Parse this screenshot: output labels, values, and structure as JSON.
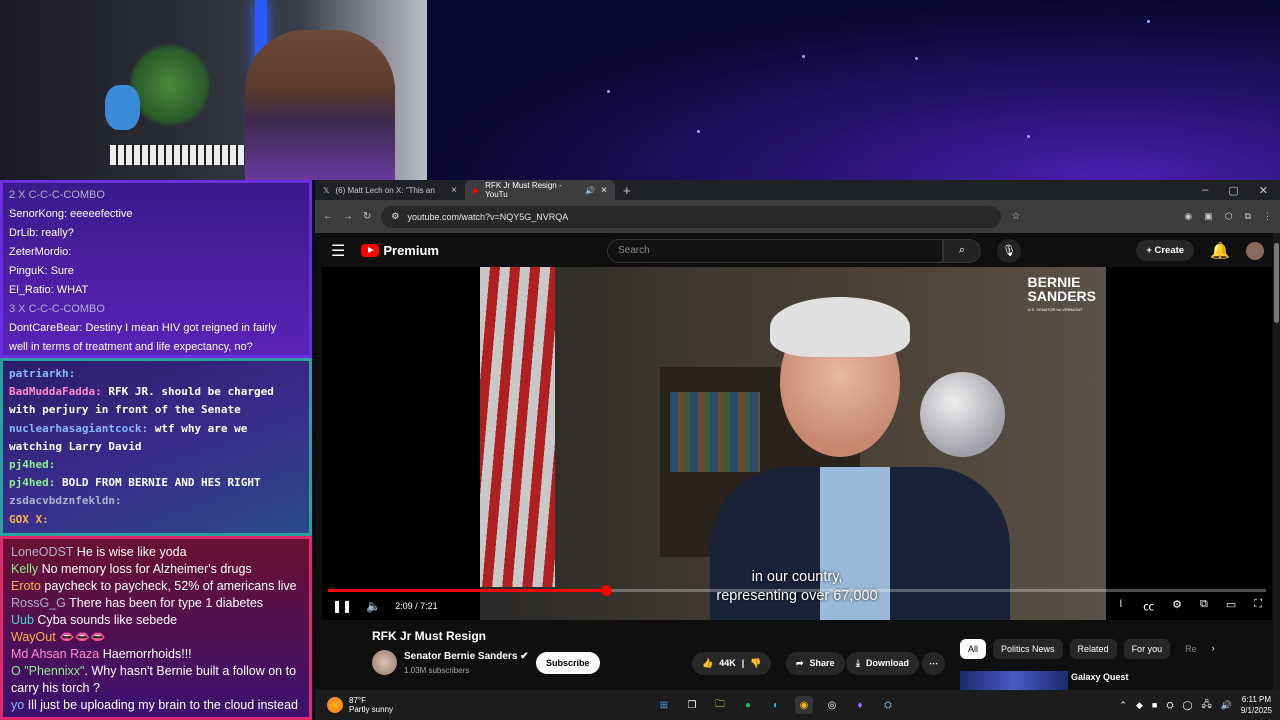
{
  "chat1": [
    {
      "user": "2 X C-C-C-COMBO",
      "msg": ""
    },
    {
      "user": "SenorKong:",
      "msg": "eeeeefective"
    },
    {
      "user": "DrLib:",
      "msg": "really?"
    },
    {
      "user": "ZeterMordio:",
      "msg": ""
    },
    {
      "user": "PinguK:",
      "msg": "Sure"
    },
    {
      "user": "El_Ratio:",
      "msg": "WHAT"
    },
    {
      "user": "3 X C-C-C-COMBO",
      "msg": ""
    },
    {
      "user": "DontCareBear:",
      "msg": "Destiny I mean HIV got reigned in fairly"
    },
    {
      "user": "",
      "msg": "well in terms of treatment and life expectancy, no?"
    }
  ],
  "chat2": [
    {
      "user": "patriarkh:",
      "msg": ""
    },
    {
      "user": "BadMuddaFadda:",
      "msg": "RFK JR. should be charged with perjury in front of the Senate"
    },
    {
      "user": "nuclearhasagiantcock:",
      "msg": "wtf why are we watching Larry David"
    },
    {
      "user": "pj4hed:",
      "msg": ""
    },
    {
      "user": "pj4hed:",
      "msg": "BOLD FROM BERNIE AND HES RIGHT"
    },
    {
      "user": "zsdacvbdznfekldn:",
      "msg": ""
    },
    {
      "user": "GOX X:",
      "msg": ""
    }
  ],
  "chat3": [
    {
      "user": "LoneODST",
      "msg": "He is wise like yoda"
    },
    {
      "user": "Kelly",
      "msg": "No memory loss for Alzheimer's drugs"
    },
    {
      "user": "Eroto",
      "msg": "paycheck to paycheck, 52% of americans live"
    },
    {
      "user": "RossG_G",
      "msg": "There has been for type 1 diabetes"
    },
    {
      "user": "Uub",
      "msg": "Cyba sounds like sebede"
    },
    {
      "user": "WayOut",
      "msg": "👄👄👄"
    },
    {
      "user": "Md Ahsan Raza",
      "msg": "Haemorrhoids!!!"
    },
    {
      "user": "O \"Phennixx\"",
      "msg": ". Why hasn't Bernie built a follow on to"
    },
    {
      "user": "",
      "msg": "carry his torch ?"
    },
    {
      "user": "yo",
      "msg": "Ill just be uploading my brain to the cloud instead"
    }
  ],
  "browser": {
    "tabs": [
      {
        "title": "(6) Matt Lech on X: \"This an",
        "icon": "x-logo-icon"
      },
      {
        "title": "RFK Jr Must Resign - YouTu",
        "icon": "youtube-icon"
      }
    ],
    "url": "youtube.com/watch?v=NQY5G_NVRQA"
  },
  "youtube": {
    "logo_text": "Premium",
    "search_placeholder": "Search",
    "create_label": "Create",
    "brand_line1": "BERNIE",
    "brand_line2": "SANDERS",
    "brand_sub": "U.S. SENATOR for VERMONT",
    "caption1": "in our country,",
    "caption2": "representing over 67,000",
    "time": "2:09 / 7:21",
    "progress": 0.296,
    "title": "RFK Jr Must Resign",
    "channel": "Senator Bernie Sanders",
    "subscribers": "1.03M subscribers",
    "subscribe_label": "Subscribe",
    "likes": "44K",
    "share_label": "Share",
    "download_label": "Download",
    "chips": [
      "All",
      "Politics News",
      "Related",
      "For you",
      "Re"
    ],
    "rec_title": "Galaxy Quest"
  },
  "taskbar": {
    "temp": "87°F",
    "weather": "Partly sunny",
    "time": "6:11 PM",
    "date": "9/1/2025"
  }
}
